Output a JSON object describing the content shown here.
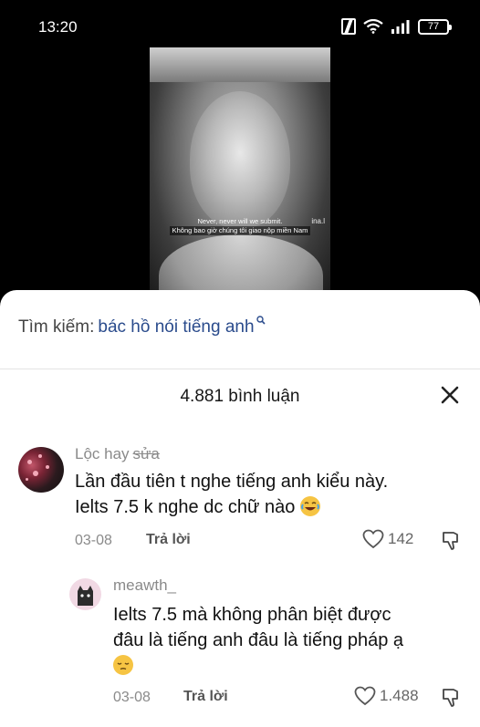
{
  "status_bar": {
    "time": "13:20",
    "battery": "77"
  },
  "video": {
    "subtitle_en": "Never, never will we submit.",
    "subtitle_vi": "Không bao giờ chúng tôi giao nộp miền Nam",
    "watermark": "ina.l"
  },
  "search": {
    "label": "Tìm kiếm:",
    "query": "bác hồ nói tiếng anh"
  },
  "comments_header": {
    "count_label": "4.881 bình luận"
  },
  "comments": [
    {
      "username": "Lộc hay",
      "username_struck": "sửa",
      "line1": "Lần đầu tiên t nghe tiếng anh kiểu này.",
      "line2": "Ielts 7.5 k nghe dc chữ nào",
      "date": "03-08",
      "reply_label": "Trả lời",
      "likes": "142"
    },
    {
      "username": "meawth_",
      "line1": "Ielts 7.5 mà không phân biệt được",
      "line2": "đâu là tiếng anh đâu là tiếng pháp ạ",
      "date": "03-08",
      "reply_label": "Trả lời",
      "likes": "1.488"
    }
  ],
  "icons": {
    "search": "search-icon",
    "close": "close-icon",
    "heart": "heart-icon",
    "dislike": "thumbs-down-icon",
    "laugh": "laughing-emoji-icon",
    "sad": "pensive-emoji-icon"
  },
  "colors": {
    "accent_query": "#2a4b8c",
    "muted": "#8a8a8a"
  }
}
